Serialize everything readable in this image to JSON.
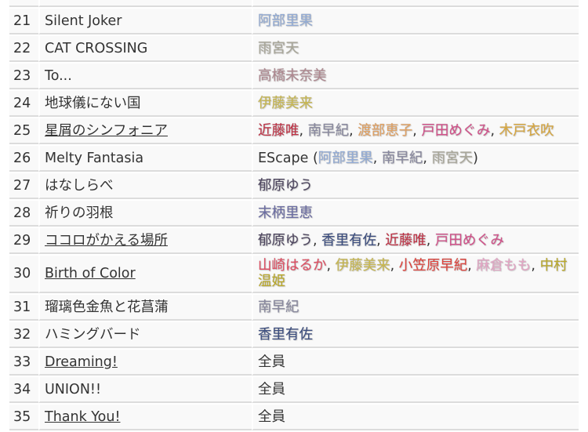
{
  "colors": {
    "阿部里果": "#93acd6",
    "雨宮天": "#a9a799",
    "高橋未奈美": "#b08890",
    "伊藤美来": "#c9b84e",
    "近藤唯": "#c23044",
    "南早紀": "#8a8aa0",
    "渡部恵子": "#e3a262",
    "戸田めぐみ": "#d4508a",
    "木戸衣吹": "#daa83e",
    "郁原ゆう": "#4e4660",
    "末柄里恵": "#6c6ea4",
    "香里有佐": "#3c4e80",
    "山崎はるか": "#e25064",
    "小笠原早紀": "#e0453e",
    "麻倉もも": "#e6a6c6",
    "中村温姫": "#bcaa2a"
  },
  "rows": [
    {
      "no": "21",
      "title": "Silent Joker",
      "link": false,
      "performers": [
        {
          "name": "阿部里果"
        }
      ]
    },
    {
      "no": "22",
      "title": "CAT CROSSING",
      "link": false,
      "performers": [
        {
          "name": "雨宮天"
        }
      ]
    },
    {
      "no": "23",
      "title": "To...",
      "link": false,
      "performers": [
        {
          "name": "高橋未奈美"
        }
      ]
    },
    {
      "no": "24",
      "title": "地球儀にない国",
      "link": false,
      "performers": [
        {
          "name": "伊藤美来"
        }
      ]
    },
    {
      "no": "25",
      "title": "星屑のシンフォニア",
      "link": true,
      "performers": [
        {
          "name": "近藤唯"
        },
        {
          "name": "南早紀"
        },
        {
          "name": "渡部恵子"
        },
        {
          "name": "戸田めぐみ"
        },
        {
          "name": "木戸衣吹"
        }
      ]
    },
    {
      "no": "26",
      "title": "Melty Fantasia",
      "link": false,
      "prefix": "EScape (",
      "suffix": ")",
      "performers": [
        {
          "name": "阿部里果"
        },
        {
          "name": "南早紀"
        },
        {
          "name": "雨宮天"
        }
      ]
    },
    {
      "no": "27",
      "title": "はなしらべ",
      "link": false,
      "performers": [
        {
          "name": "郁原ゆう"
        }
      ]
    },
    {
      "no": "28",
      "title": "祈りの羽根",
      "link": false,
      "performers": [
        {
          "name": "末柄里恵"
        }
      ]
    },
    {
      "no": "29",
      "title": "ココロがかえる場所",
      "link": true,
      "performers": [
        {
          "name": "郁原ゆう"
        },
        {
          "name": "香里有佐"
        },
        {
          "name": "近藤唯"
        },
        {
          "name": "戸田めぐみ"
        }
      ]
    },
    {
      "no": "30",
      "title": "Birth of Color",
      "link": true,
      "performers": [
        {
          "name": "山崎はるか"
        },
        {
          "name": "伊藤美来"
        },
        {
          "name": "小笠原早紀"
        },
        {
          "name": "麻倉もも"
        },
        {
          "name": "中村温姫"
        }
      ]
    },
    {
      "no": "31",
      "title": "瑠璃色金魚と花菖蒲",
      "link": false,
      "performers": [
        {
          "name": "南早紀"
        }
      ]
    },
    {
      "no": "32",
      "title": "ハミングバード",
      "link": false,
      "performers": [
        {
          "name": "香里有佐"
        }
      ]
    },
    {
      "no": "33",
      "title": "Dreaming!",
      "link": true,
      "plain": "全員"
    },
    {
      "no": "34",
      "title": "UNION!!",
      "link": false,
      "plain": "全員"
    },
    {
      "no": "35",
      "title": "Thank You!",
      "link": true,
      "plain": "全員"
    }
  ]
}
